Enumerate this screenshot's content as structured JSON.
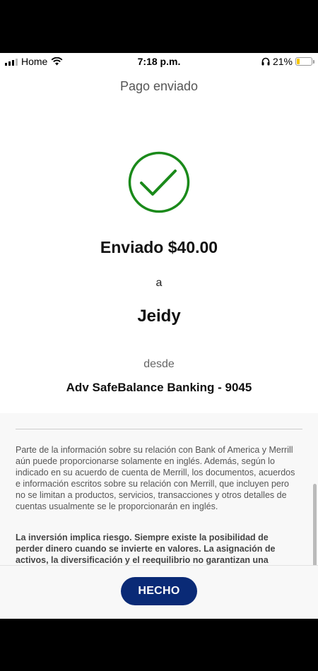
{
  "status_bar": {
    "carrier": "Home",
    "time": "7:18 p.m.",
    "battery_percent": "21%",
    "battery_level": 0.21,
    "battery_color": "#f5c400",
    "icons": [
      "signal-icon",
      "wifi-icon",
      "headphones-icon",
      "battery-icon"
    ]
  },
  "header": {
    "title": "Pago enviado"
  },
  "confirmation": {
    "icon": "checkmark-circle-icon",
    "icon_color": "#1a8a1a",
    "sent_label": "Enviado $40.00",
    "to_word": "a",
    "recipient": "Jeidy",
    "from_word": "desde",
    "account": "Adv SafeBalance Banking - 9045"
  },
  "disclosure": {
    "paragraph1": "Parte de la información sobre su relación con Bank of America y Merrill aún puede proporcionarse solamente en inglés. Además, según lo indicado en su acuerdo de cuenta de Merrill, los documentos, acuerdos e información escritos sobre su relación con Merrill, que incluyen pero no se limitan a productos, servicios, transacciones y otros detalles de cuentas usualmente se le proporcionarán en inglés.",
    "paragraph2": "La inversión implica riesgo. Siempre existe la posibilidad de perder dinero cuando se invierte en valores. La asignación de activos, la diversificación y el reequilibrio no garantizan una"
  },
  "footer": {
    "done_label": "HECHO",
    "button_color": "#0a2a76"
  }
}
